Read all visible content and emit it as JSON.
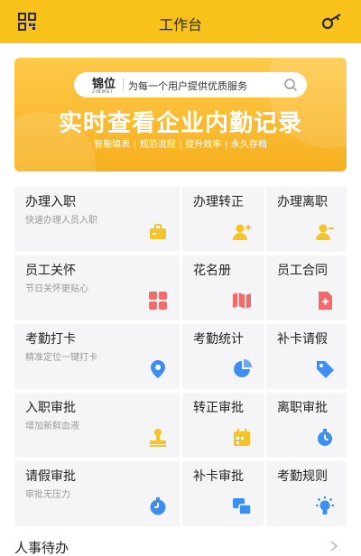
{
  "header": {
    "title": "工作台",
    "left_icon": "qr-scan-icon",
    "right_icon": "key-icon",
    "bg": "#f8c21a"
  },
  "banner": {
    "logo_text": "锦位",
    "logo_sub": "JINWEI",
    "slogan": "为每一个用户提供优质服务",
    "headline": "实时查看企业内勤记录",
    "tags": [
      "智能填表",
      "规范流程",
      "提升效率",
      "永久存档"
    ]
  },
  "grid": [
    {
      "label": "办理入职",
      "sub": "快速办理人员入职",
      "icon": "briefcase-icon",
      "color": "#f6c32a"
    },
    {
      "label": "办理转正",
      "sub": "",
      "icon": "user-add-icon",
      "color": "#f6c32a"
    },
    {
      "label": "办理离职",
      "sub": "",
      "icon": "user-remove-icon",
      "color": "#f6c32a"
    },
    {
      "label": "员工关怀",
      "sub": "节日关怀更贴心",
      "icon": "grid-apps-icon",
      "color": "#f36a6a"
    },
    {
      "label": "花名册",
      "sub": "",
      "icon": "book-icon",
      "color": "#f36a6a"
    },
    {
      "label": "员工合同",
      "sub": "",
      "icon": "contract-icon",
      "color": "#f36a6a"
    },
    {
      "label": "考勤打卡",
      "sub": "精准定位一键打卡",
      "icon": "location-icon",
      "color": "#3d8ef0"
    },
    {
      "label": "考勤统计",
      "sub": "",
      "icon": "pie-chart-icon",
      "color": "#3d8ef0"
    },
    {
      "label": "补卡请假",
      "sub": "",
      "icon": "tag-icon",
      "color": "#3d8ef0"
    },
    {
      "label": "入职审批",
      "sub": "增加新鲜血液",
      "icon": "stamp-icon",
      "color": "#f6c32a"
    },
    {
      "label": "转正审批",
      "sub": "",
      "icon": "calendar-icon",
      "color": "#f6c32a"
    },
    {
      "label": "离职审批",
      "sub": "",
      "icon": "alarm-clock-icon",
      "color": "#3d8ef0"
    },
    {
      "label": "请假审批",
      "sub": "审批无压力",
      "icon": "stopwatch-icon",
      "color": "#3d8ef0"
    },
    {
      "label": "补卡审批",
      "sub": "",
      "icon": "cards-icon",
      "color": "#3d8ef0"
    },
    {
      "label": "考勤规则",
      "sub": "",
      "icon": "bulb-icon",
      "color": "#3d8ef0"
    }
  ],
  "section": {
    "title": "人事待办"
  }
}
